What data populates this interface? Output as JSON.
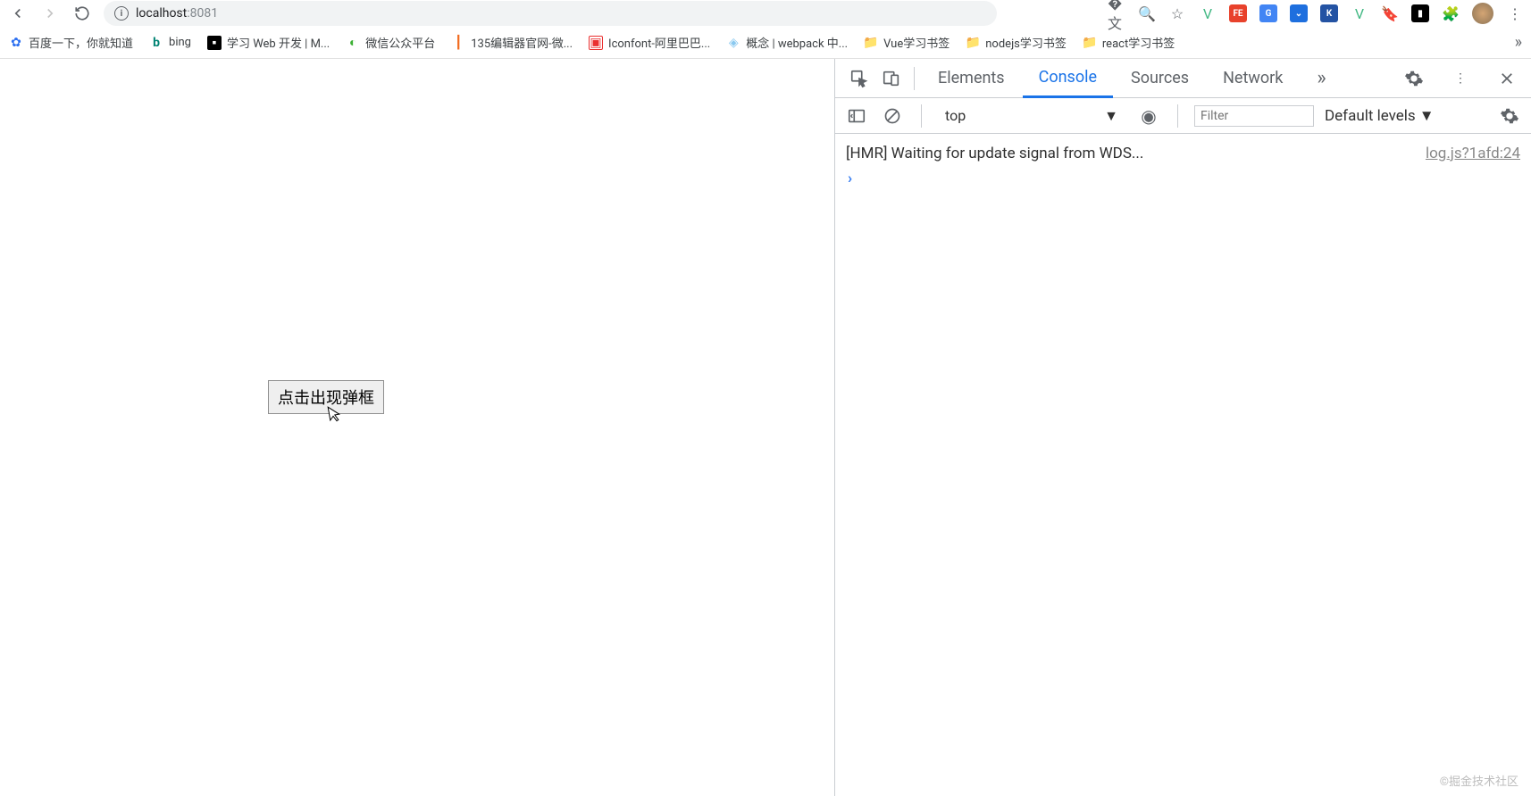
{
  "address": {
    "host": "localhost",
    "port": ":8081"
  },
  "bookmarks": [
    {
      "label": "百度一下，你就知道",
      "iconColor": "#2a6ef0",
      "glyph": "✿"
    },
    {
      "label": "bing",
      "iconColor": "#008373",
      "glyph": "b"
    },
    {
      "label": "学习 Web 开发 | M...",
      "iconColor": "#000",
      "glyph": "◼"
    },
    {
      "label": "微信公众平台",
      "iconColor": "#3cb034",
      "glyph": "●"
    },
    {
      "label": "135编辑器官网-微...",
      "iconColor": "#f26b1f",
      "glyph": "|"
    },
    {
      "label": "Iconfont-阿里巴巴...",
      "iconColor": "#ea2f2f",
      "glyph": "◧"
    },
    {
      "label": "概念 | webpack 中...",
      "iconColor": "#8ac9f0",
      "glyph": "◆"
    },
    {
      "label": "Vue学习书签",
      "iconColor": "#f6ca4c",
      "glyph": "📁",
      "isFolder": true
    },
    {
      "label": "nodejs学习书签",
      "iconColor": "#f6ca4c",
      "glyph": "📁",
      "isFolder": true
    },
    {
      "label": "react学习书签",
      "iconColor": "#f6ca4c",
      "glyph": "📁",
      "isFolder": true
    }
  ],
  "page": {
    "buttonLabel": "点击出现弹框"
  },
  "devtools": {
    "tabs": {
      "elements": "Elements",
      "console": "Console",
      "sources": "Sources",
      "network": "Network"
    },
    "subbar": {
      "context": "top",
      "filterPlaceholder": "Filter",
      "levels": "Default levels"
    },
    "log": {
      "message": "[HMR] Waiting for update signal from WDS...",
      "source": "log.js?1afd:24"
    }
  },
  "watermark": "©掘金技术社区"
}
